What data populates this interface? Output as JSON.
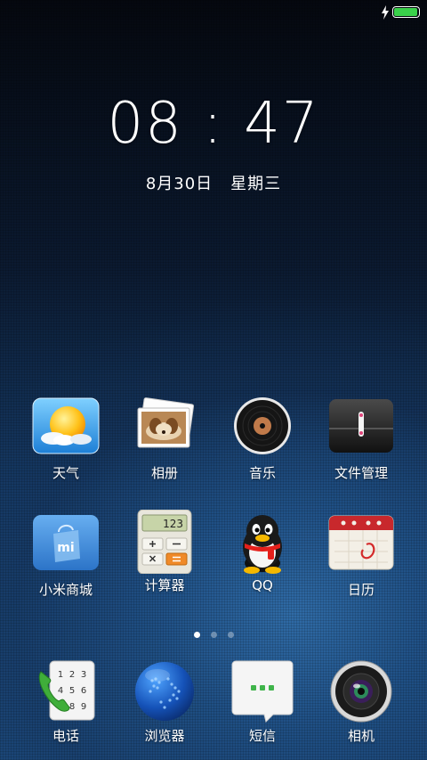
{
  "status": {
    "battery_level": 1.0,
    "charging": true,
    "battery_color": "#3ad14a"
  },
  "clock": {
    "time": "08 : 47",
    "date": "8月30日",
    "weekday": "星期三"
  },
  "apps_row1": [
    {
      "label": "天气",
      "icon": "weather-icon"
    },
    {
      "label": "相册",
      "icon": "gallery-icon"
    },
    {
      "label": "音乐",
      "icon": "music-icon"
    },
    {
      "label": "文件管理",
      "icon": "file-manager-icon"
    }
  ],
  "apps_row2": [
    {
      "label": "小米商城",
      "icon": "mi-store-icon"
    },
    {
      "label": "计算器",
      "icon": "calculator-icon",
      "display": "123"
    },
    {
      "label": "QQ",
      "icon": "qq-icon"
    },
    {
      "label": "日历",
      "icon": "calendar-icon"
    }
  ],
  "pager": {
    "pages": 3,
    "current": 1
  },
  "dock": [
    {
      "label": "电话",
      "icon": "phone-icon",
      "keys": [
        "1",
        "2",
        "3",
        "4",
        "5",
        "6",
        "7",
        "8",
        "9"
      ]
    },
    {
      "label": "浏览器",
      "icon": "browser-icon"
    },
    {
      "label": "短信",
      "icon": "messages-icon"
    },
    {
      "label": "相机",
      "icon": "camera-icon"
    }
  ]
}
